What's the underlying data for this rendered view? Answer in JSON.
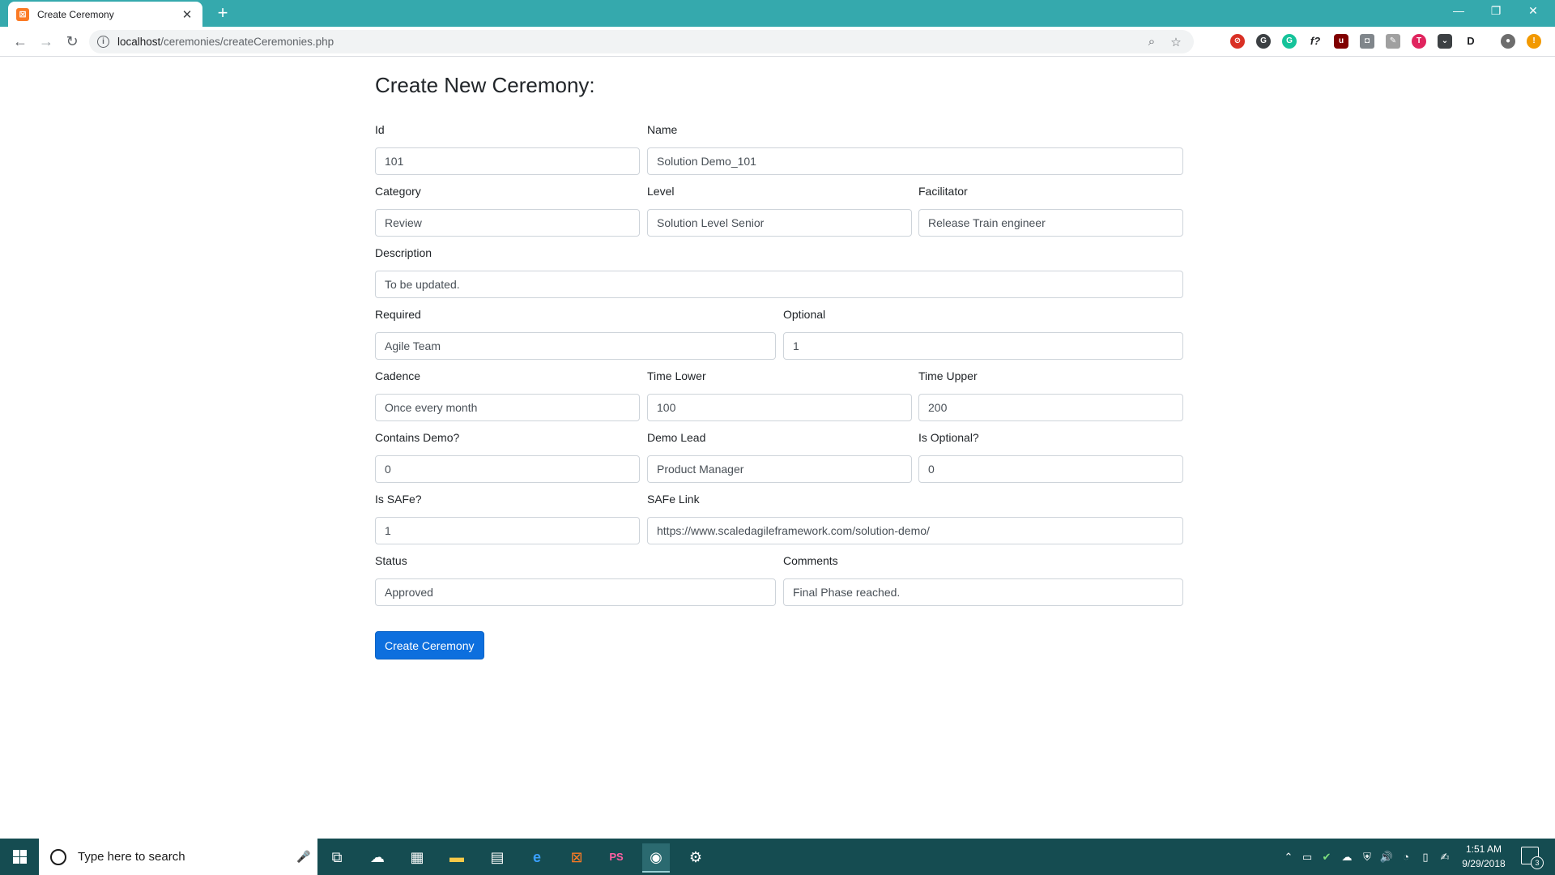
{
  "browser": {
    "tab_title": "Create Ceremony",
    "tab_close": "✕",
    "new_tab": "+",
    "url_host": "localhost",
    "url_path": "/ceremonies/createCeremonies.php",
    "window_controls": {
      "minimize": "—",
      "maximize": "❐",
      "close": "✕"
    },
    "nav": {
      "back": "←",
      "forward": "→",
      "reload": "↻"
    },
    "extensions": [
      "block-icon",
      "grammar-icon",
      "grammarly-icon",
      "formula-icon",
      "ublock-icon",
      "camera-icon",
      "pencil-icon",
      "tripadvisor-icon",
      "pocket-icon",
      "dashlane-icon",
      "profile-avatar",
      "update-icon"
    ]
  },
  "form": {
    "title": "Create New Ceremony:",
    "fields": {
      "id": {
        "label": "Id",
        "value": "101"
      },
      "name": {
        "label": "Name",
        "value": "Solution Demo_101"
      },
      "category": {
        "label": "Category",
        "value": "Review"
      },
      "level": {
        "label": "Level",
        "value": "Solution Level Senior"
      },
      "facilitator": {
        "label": "Facilitator",
        "value": "Release Train engineer"
      },
      "description": {
        "label": "Description",
        "value": "To be updated."
      },
      "required": {
        "label": "Required",
        "value": "Agile Team"
      },
      "optional": {
        "label": "Optional",
        "value": "1"
      },
      "cadence": {
        "label": "Cadence",
        "value": "Once every month"
      },
      "time_lower": {
        "label": "Time Lower",
        "value": "100"
      },
      "time_upper": {
        "label": "Time Upper",
        "value": "200"
      },
      "contains_demo": {
        "label": "Contains Demo?",
        "value": "0"
      },
      "demo_lead": {
        "label": "Demo Lead",
        "value": "Product Manager"
      },
      "is_optional": {
        "label": "Is Optional?",
        "value": "0"
      },
      "is_safe": {
        "label": "Is SAFe?",
        "value": "1"
      },
      "safe_link": {
        "label": "SAFe Link",
        "value": "https://www.scaledagileframework.com/solution-demo/"
      },
      "status": {
        "label": "Status",
        "value": "Approved"
      },
      "comments": {
        "label": "Comments",
        "value": "Final Phase reached."
      }
    },
    "submit_label": "Create Ceremony"
  },
  "taskbar": {
    "search_placeholder": "Type here to search",
    "clock_time": "1:51 AM",
    "clock_date": "9/29/2018",
    "notification_count": "3"
  }
}
